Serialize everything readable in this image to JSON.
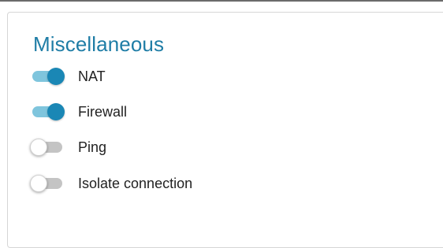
{
  "section": {
    "title": "Miscellaneous"
  },
  "toggles": [
    {
      "label": "NAT",
      "checked": true
    },
    {
      "label": "Firewall",
      "checked": true
    },
    {
      "label": "Ping",
      "checked": false
    },
    {
      "label": "Isolate connection",
      "checked": false
    }
  ],
  "colors": {
    "title": "#1f7da6",
    "toggle_on_knob": "#1a87b5",
    "toggle_on_track": "#7fc5dd",
    "toggle_off_track": "#c4c4c4",
    "toggle_off_knob": "#ffffff",
    "label_text": "#222222"
  }
}
